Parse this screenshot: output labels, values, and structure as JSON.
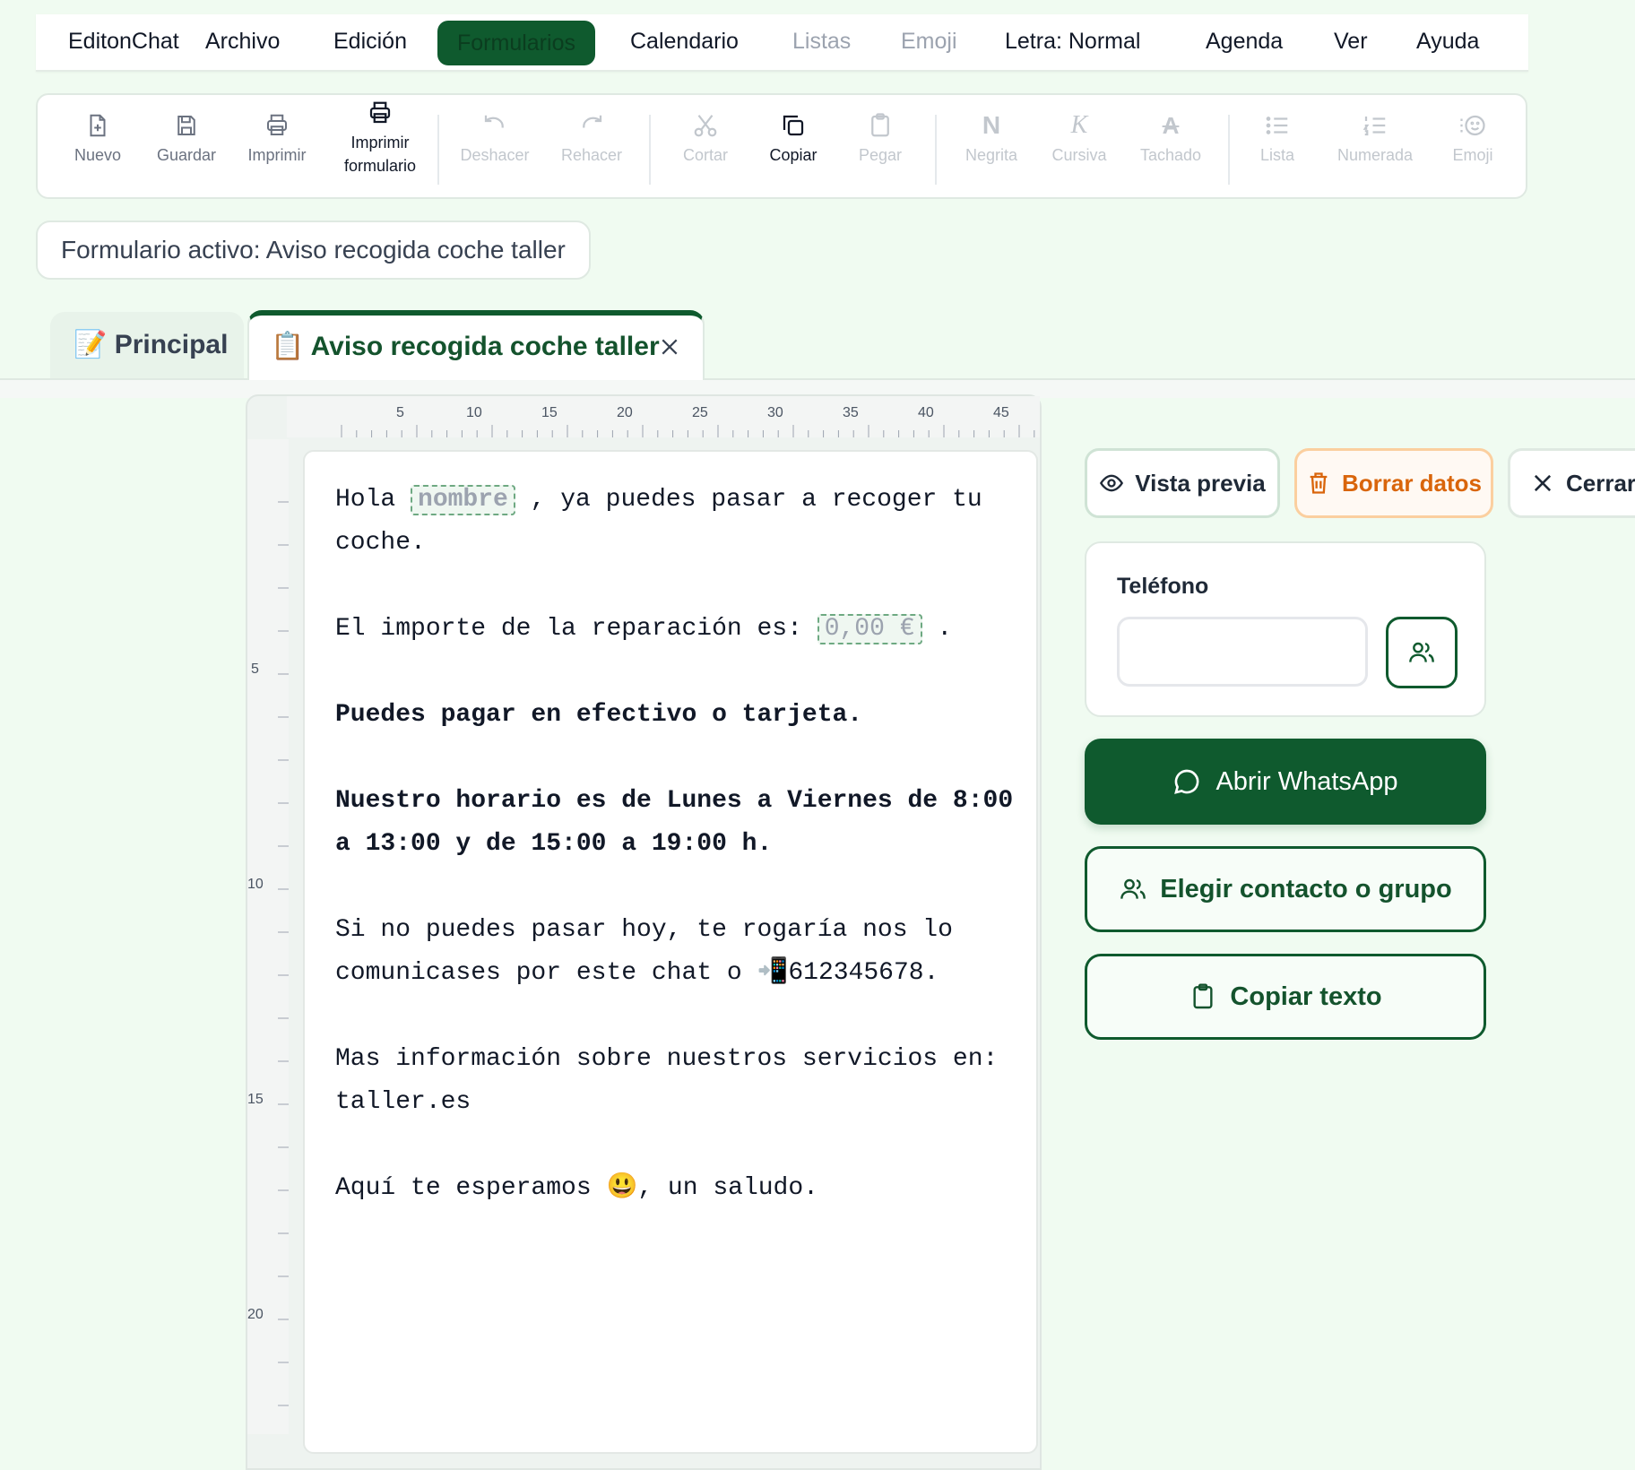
{
  "menubar": {
    "items": [
      "EditonChat",
      "Archivo",
      "Edición",
      "Formularios",
      "Calendario",
      "Listas",
      "Emoji",
      "Letra: Normal",
      "Agenda",
      "Ver",
      "Ayuda"
    ]
  },
  "toolbar": {
    "nuevo": "Nuevo",
    "guardar": "Guardar",
    "imprimir": "Imprimir",
    "imprimir_form_1": "Imprimir",
    "imprimir_form_2": "formulario",
    "deshacer": "Deshacer",
    "rehacer": "Rehacer",
    "cortar": "Cortar",
    "copiar": "Copiar",
    "pegar": "Pegar",
    "negrita": "Negrita",
    "negrita_glyph": "N",
    "cursiva": "Cursiva",
    "cursiva_glyph": "K",
    "tachado": "Tachado",
    "tachado_glyph": "A",
    "lista": "Lista",
    "numerada": "Numerada",
    "emoji": "Emoji"
  },
  "active_form": "Formulario activo: Aviso recogida coche taller",
  "tabs": {
    "principal_icon": "📝",
    "principal": "Principal",
    "active_icon": "📋",
    "active": "Aviso recogida coche taller"
  },
  "ruler": {
    "top": [
      "5",
      "10",
      "15",
      "20",
      "25",
      "30",
      "35",
      "40",
      "45"
    ],
    "left": [
      "5",
      "10",
      "15",
      "20"
    ]
  },
  "document": {
    "line1_a": "Hola ",
    "field_nombre": "nombre",
    "line1_b": " , ya puedes pasar a recoger tu coche.",
    "line2_a": "El importe de la reparación es: ",
    "field_importe": "0,00 €",
    "line2_b": " .",
    "line3": "Puedes pagar en efectivo o tarjeta.",
    "line4": "Nuestro horario es de Lunes a Viernes de 8:00 a 13:00 y de 15:00 a 19:00 h.",
    "line5": "Si no puedes pasar hoy, te rogaría nos lo comunicases por este chat o 📲612345678.",
    "line6": "Mas información sobre nuestros servicios en: taller.es",
    "line7_a": "Aquí te esperamos ",
    "line7_emoji": "😃",
    "line7_b": ", un saludo."
  },
  "actions": {
    "preview": "Vista previa",
    "delete": "Borrar datos",
    "close": "Cerrar"
  },
  "phone": {
    "label": "Teléfono",
    "value": ""
  },
  "buttons": {
    "whatsapp": "Abrir WhatsApp",
    "contact": "Elegir contacto o grupo",
    "copy_text": "Copiar texto"
  },
  "colors": {
    "primary": "#0f5a2e",
    "background": "#f0fbf1",
    "danger": "#d9650b"
  }
}
